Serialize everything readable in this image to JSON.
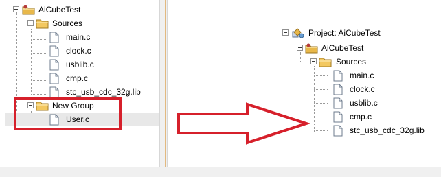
{
  "left_tree": {
    "target": "AiCubeTest",
    "group_sources": "Sources",
    "files": [
      "main.c",
      "clock.c",
      "usblib.c",
      "cmp.c",
      "stc_usb_cdc_32g.lib"
    ],
    "new_group": "New Group",
    "new_file": "User.c"
  },
  "right_tree": {
    "project": "Project: AiCubeTest",
    "target": "AiCubeTest",
    "group_sources": "Sources",
    "files": [
      "main.c",
      "clock.c",
      "usblib.c",
      "cmp.c",
      "stc_usb_cdc_32g.lib"
    ]
  },
  "colors": {
    "highlight": "#d6202b",
    "folder": "#e8b84a",
    "selection": "#e8e8e8"
  },
  "icons": {
    "project": "project-icon",
    "target": "target-folder-icon",
    "group": "folder-icon",
    "file": "file-icon",
    "arrow": "arrow-right-icon"
  }
}
